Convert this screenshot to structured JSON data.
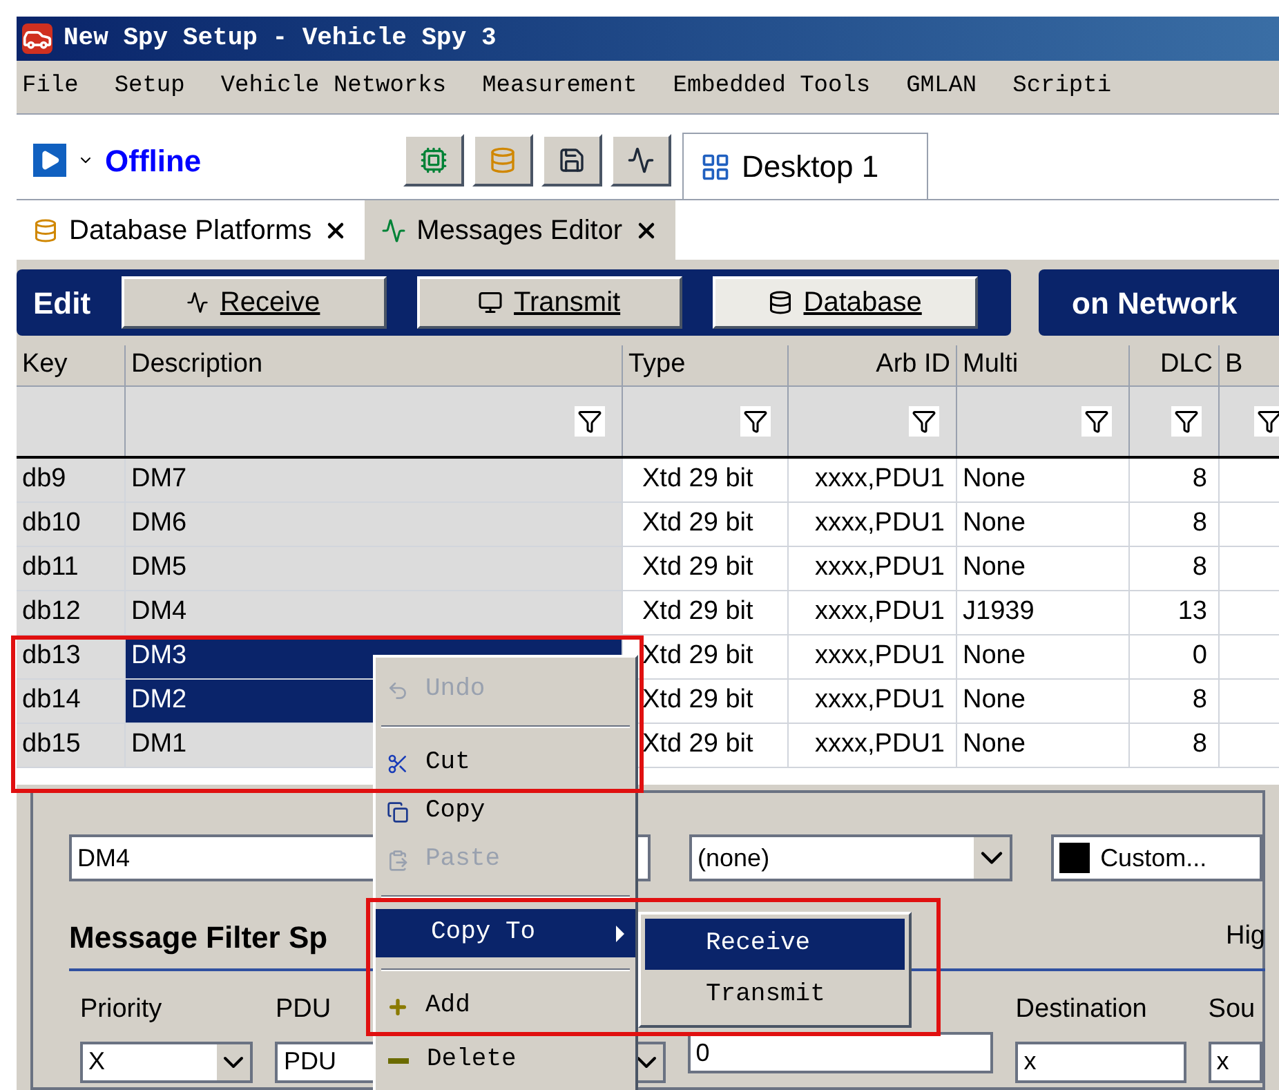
{
  "window": {
    "title": "New Spy Setup - Vehicle Spy 3"
  },
  "menu_bar": [
    "File",
    "Setup",
    "Vehicle Networks",
    "Measurement",
    "Embedded Tools",
    "GMLAN",
    "Scripti"
  ],
  "toolbar": {
    "status": "Offline",
    "desktop_tab": "Desktop 1"
  },
  "doc_tabs": [
    {
      "label": "Database Platforms",
      "selected": false
    },
    {
      "label": "Messages Editor",
      "selected": true
    }
  ],
  "edit_bar": {
    "label": "Edit",
    "buttons": [
      {
        "label": "Receive",
        "selected": false
      },
      {
        "label": "Transmit",
        "selected": false
      },
      {
        "label": "Database",
        "selected": true
      }
    ],
    "network_label": "on Network"
  },
  "table": {
    "columns": [
      "Key",
      "Description",
      "Type",
      "Arb ID",
      "Multi",
      "DLC",
      "B"
    ],
    "rows": [
      {
        "cells": [
          "db9",
          "DM7",
          "Xtd 29 bit",
          "xxxx,PDU1",
          "None",
          "8"
        ],
        "selected": false
      },
      {
        "cells": [
          "db10",
          "DM6",
          "Xtd 29 bit",
          "xxxx,PDU1",
          "None",
          "8"
        ],
        "selected": false
      },
      {
        "cells": [
          "db11",
          "DM5",
          "Xtd 29 bit",
          "xxxx,PDU1",
          "None",
          "8"
        ],
        "selected": false
      },
      {
        "cells": [
          "db12",
          "DM4",
          "Xtd 29 bit",
          "xxxx,PDU1",
          "J1939",
          "13"
        ],
        "selected": false
      },
      {
        "cells": [
          "db13",
          "DM3",
          "Xtd 29 bit",
          "xxxx,PDU1",
          "None",
          "0"
        ],
        "selected": true
      },
      {
        "cells": [
          "db14",
          "DM2",
          "Xtd 29 bit",
          "xxxx,PDU1",
          "None",
          "8"
        ],
        "selected": true
      },
      {
        "cells": [
          "db15",
          "DM1",
          "Xtd 29 bit",
          "xxxx,PDU1",
          "None",
          "8"
        ],
        "selected": false
      }
    ]
  },
  "form": {
    "name_value": "DM4",
    "type_value": "(none)",
    "color_value": "Custom...",
    "section_title": "Message Filter Sp",
    "section_hint": "Hig",
    "fields": [
      {
        "label": "Priority",
        "value": "X",
        "kind": "dropdown"
      },
      {
        "label": "PDU",
        "value": "PDU",
        "kind": "dropdown"
      },
      {
        "value": "0",
        "kind": "text"
      },
      {
        "label": "Destination",
        "value": "x",
        "kind": "text"
      },
      {
        "label": "Sou",
        "value": "x",
        "kind": "text"
      }
    ]
  },
  "context_menu": {
    "items": [
      {
        "kind": "item",
        "label": "Undo",
        "disabled": true,
        "selected": false
      },
      {
        "kind": "separator"
      },
      {
        "kind": "item",
        "label": "Cut",
        "disabled": false,
        "selected": false
      },
      {
        "kind": "item",
        "label": "Copy",
        "disabled": false,
        "selected": false
      },
      {
        "kind": "item",
        "label": "Paste",
        "disabled": true,
        "selected": false
      },
      {
        "kind": "separator"
      },
      {
        "kind": "submenu",
        "label": "Copy To",
        "disabled": false,
        "selected": true
      },
      {
        "kind": "separator"
      },
      {
        "kind": "item",
        "label": "Add",
        "disabled": false,
        "selected": false
      },
      {
        "kind": "item",
        "label": "Delete",
        "disabled": false,
        "selected": false
      }
    ],
    "submenu": [
      {
        "label": "Receive",
        "selected": true
      },
      {
        "label": "Transmit",
        "selected": false
      }
    ]
  }
}
